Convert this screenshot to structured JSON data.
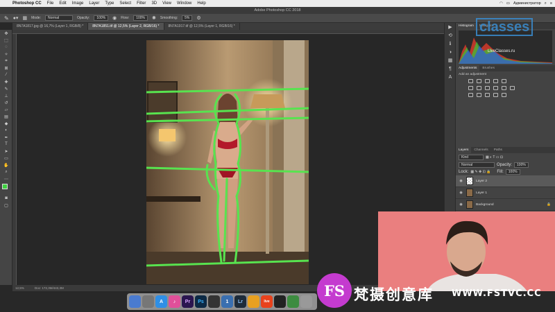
{
  "menubar": {
    "app_name": "Photoshop CC",
    "items": [
      "File",
      "Edit",
      "Image",
      "Layer",
      "Type",
      "Select",
      "Filter",
      "3D",
      "View",
      "Window",
      "Help"
    ],
    "user": "Администратор"
  },
  "window": {
    "title": "Adobe Photoshop CC 2018"
  },
  "options": {
    "mode_label": "Mode:",
    "mode_value": "Normal",
    "opacity_label": "Opacity:",
    "opacity_value": "100%",
    "flow_label": "Flow:",
    "flow_value": "100%",
    "smoothing_label": "Smoothing:",
    "smoothing_value": "5%"
  },
  "tabs": [
    {
      "label": "8N7A1817.jpg @ 16,7% (Layer 1, RGB/8) *"
    },
    {
      "label": "8N7A1851.tif @ 12,5% (Layer 2, RGB/16) *"
    },
    {
      "label": "8N7A1917.tif @ 12,5% (Layer 1, RGB/16) *"
    }
  ],
  "status": {
    "zoom": "12,5%",
    "doc": "Doc: 172,3M/443,3M"
  },
  "panels": {
    "histogram_tab": "Histogram",
    "navigator_tab": "Navigator",
    "adjustments_tab": "Adjustments",
    "brushes_tab": "Brushes",
    "add_adjustment": "Add an adjustment",
    "layers_tab": "Layers",
    "channels_tab": "Channels",
    "paths_tab": "Paths",
    "kind_value": "Kind",
    "blend_value": "Normal",
    "opacity_label": "Opacity:",
    "opacity_value": "100%",
    "lock_label": "Lock:",
    "fill_label": "Fill:",
    "fill_value": "100%",
    "layers": [
      {
        "name": "Layer 2"
      },
      {
        "name": "Layer 1"
      },
      {
        "name": "Background"
      }
    ]
  },
  "watermark": {
    "classes_logo": "classes",
    "classes_url": "LiveClasses.ru",
    "fs_logo": "FS",
    "title": "梵摄创意库",
    "url": "WWW.FSTVC.CC"
  },
  "dock": [
    {
      "icon": "finder-icon",
      "color": "#4a7bd0",
      "label": ""
    },
    {
      "icon": "launchpad-icon",
      "color": "#777",
      "label": ""
    },
    {
      "icon": "appstore-icon",
      "color": "#2f8fe6",
      "label": "A"
    },
    {
      "icon": "itunes-icon",
      "color": "#e0509a",
      "label": "♪"
    },
    {
      "icon": "premiere-icon",
      "color": "#2b1650",
      "label": "Pr"
    },
    {
      "icon": "photoshop-icon",
      "color": "#0c2a45",
      "label": "Ps"
    },
    {
      "icon": "terminal-icon",
      "color": "#333",
      "label": ""
    },
    {
      "icon": "1password-icon",
      "color": "#3a6fb0",
      "label": "1"
    },
    {
      "icon": "lightroom-icon",
      "color": "#1d2b3a",
      "label": "Lr"
    },
    {
      "icon": "app-icon",
      "color": "#e8a020",
      "label": ""
    },
    {
      "icon": "live-icon",
      "color": "#e8421c",
      "label": "live"
    },
    {
      "icon": "obs-icon",
      "color": "#222",
      "label": ""
    },
    {
      "icon": "chrome-icon",
      "color": "#3d8c40",
      "label": ""
    },
    {
      "icon": "trash-icon",
      "color": "#999",
      "label": ""
    }
  ]
}
